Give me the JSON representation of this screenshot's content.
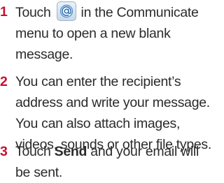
{
  "steps": [
    {
      "number": "1",
      "text_before_icon": "Touch",
      "icon": "email-at-icon",
      "line1_after_icon": "in the Communicate",
      "line2": "menu to open a new blank",
      "line3": "message."
    },
    {
      "number": "2",
      "line1": "You can enter the recipient’s",
      "line2": "address and write your message.",
      "line3": "You can also attach images,",
      "line4": "videos, sounds or other file types."
    },
    {
      "number": "3",
      "text_before_bold": "Touch",
      "bold": "Send",
      "text_after_bold": "and your email will",
      "line2": "be sent."
    }
  ],
  "colors": {
    "step_number": "#c8102e",
    "body_text": "#2b2b2b"
  }
}
